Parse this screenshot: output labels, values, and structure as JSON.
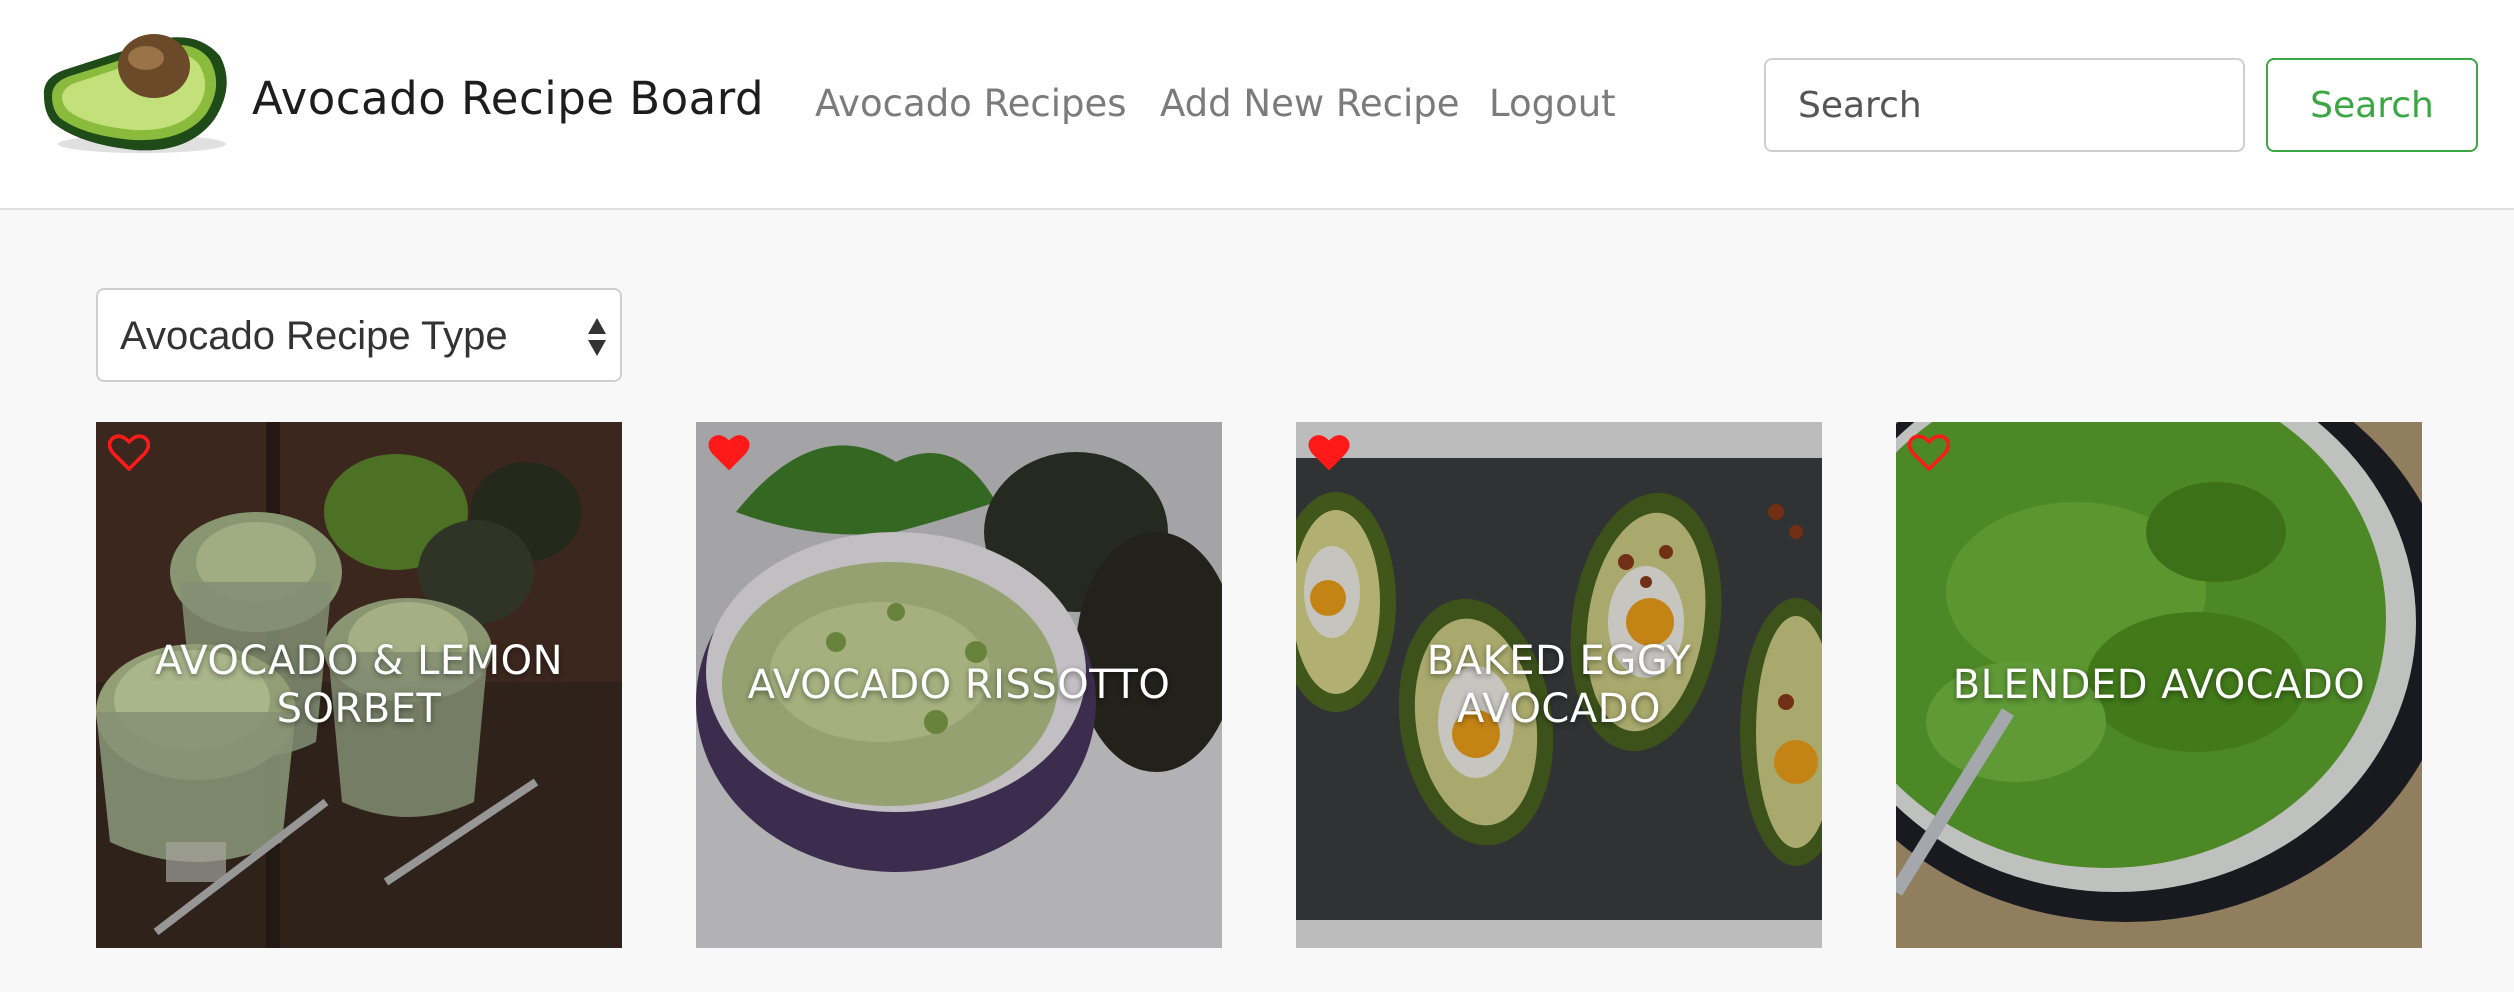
{
  "brand": {
    "name": "Avocado Recipe Board",
    "logo": "avocado-half-logo"
  },
  "nav": {
    "links": [
      "Avocado Recipes",
      "Add New Recipe",
      "Logout"
    ]
  },
  "search": {
    "placeholder": "Search",
    "button_label": "Search"
  },
  "filter": {
    "selected": "Avocado Recipe Type"
  },
  "colors": {
    "accent_green": "#3aa744",
    "heart_red": "#ff1a1a",
    "nav_link": "#7b7b7b",
    "background": "#f8f8f8"
  },
  "recipes": [
    {
      "title": "AVOCADO & LEMON SORBET",
      "favorited": false,
      "icon": "heart-outline-icon"
    },
    {
      "title": "AVOCADO RISSOTTO",
      "favorited": true,
      "icon": "heart-filled-icon"
    },
    {
      "title": "BAKED EGGY AVOCADO",
      "favorited": true,
      "icon": "heart-filled-icon"
    },
    {
      "title": "BLENDED AVOCADO",
      "favorited": false,
      "icon": "heart-outline-icon"
    }
  ]
}
